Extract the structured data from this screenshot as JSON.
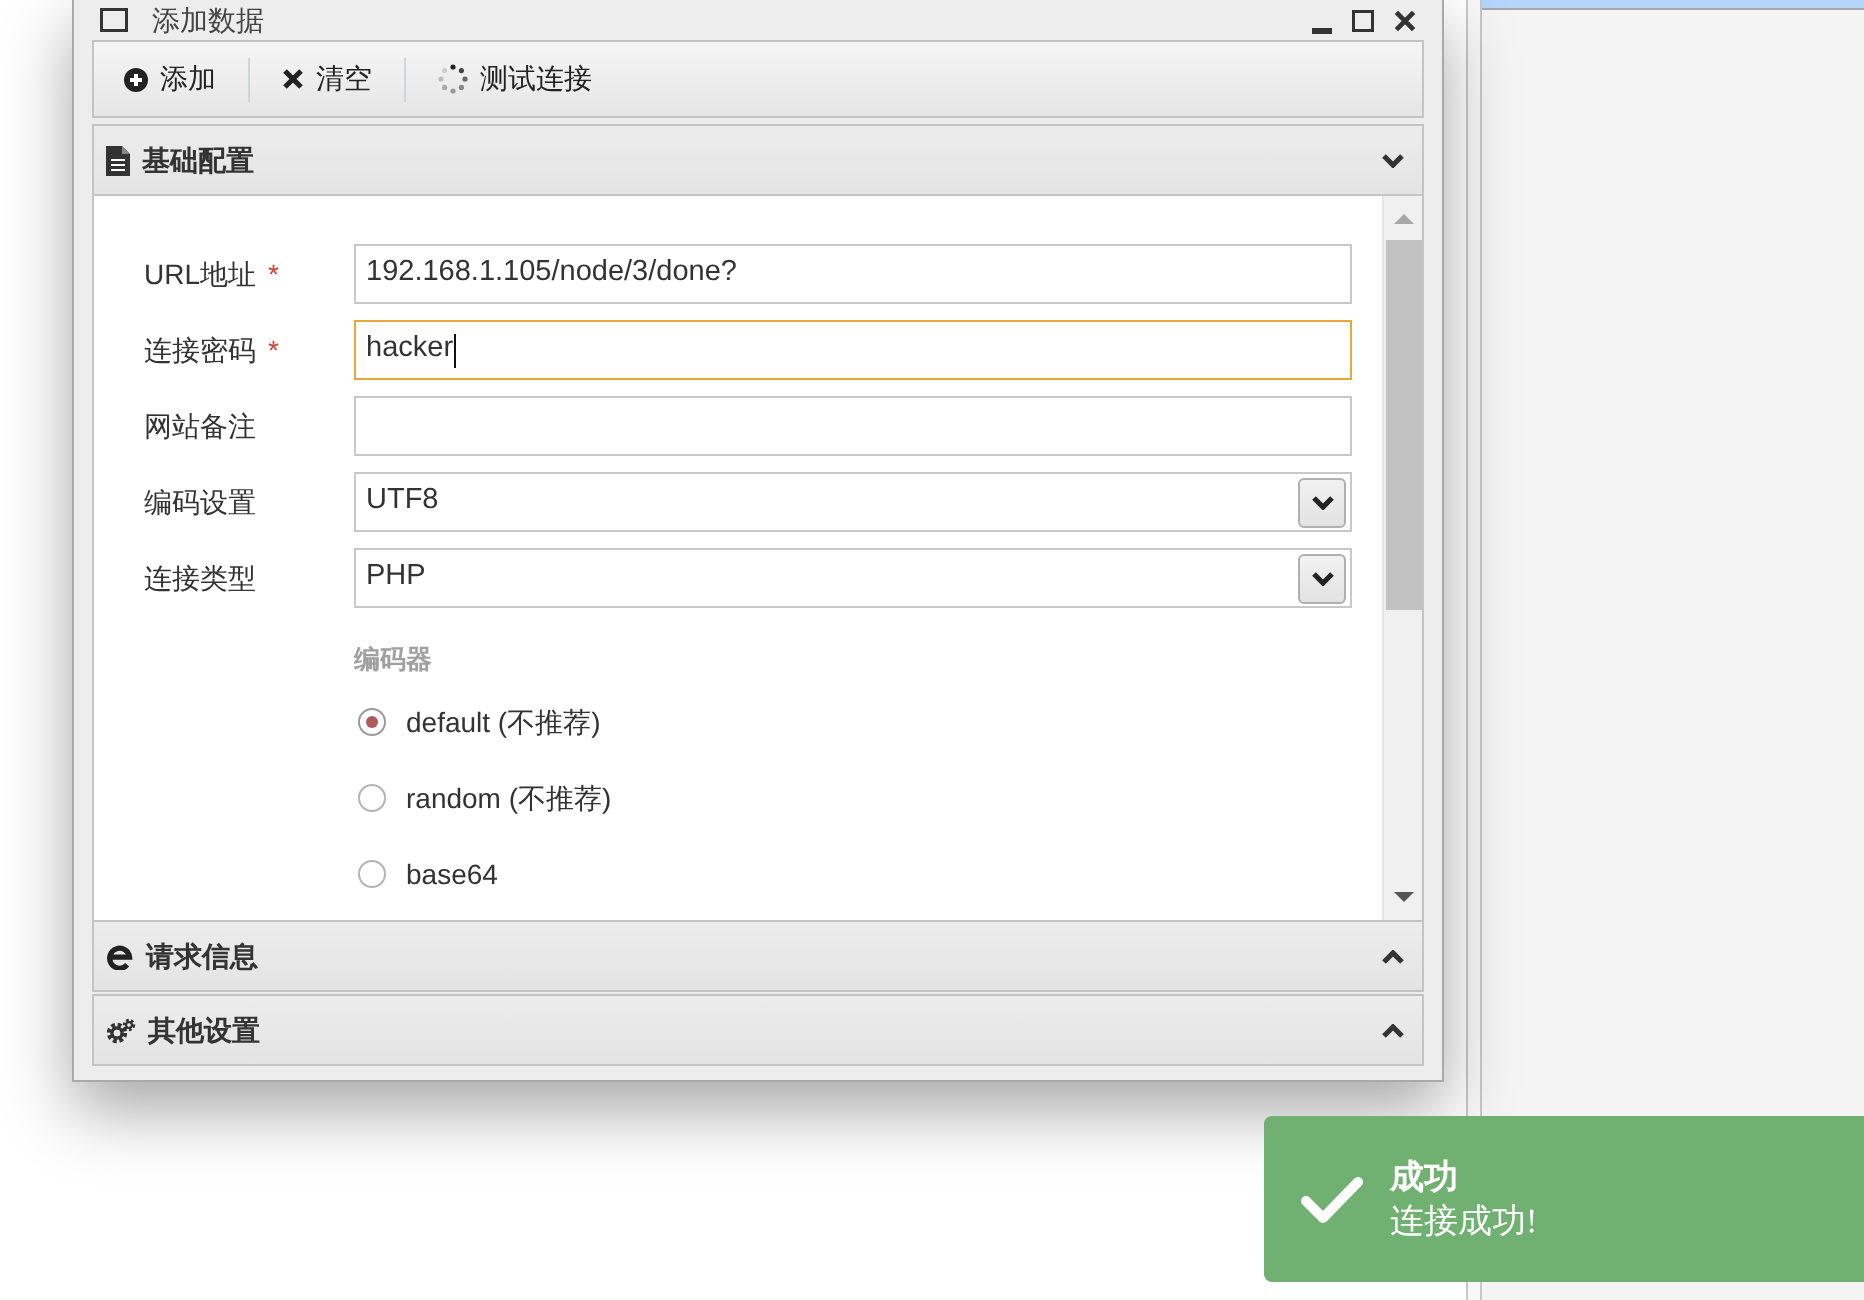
{
  "window": {
    "title": "添加数据"
  },
  "toolbar": {
    "buttons": [
      {
        "label": "添加"
      },
      {
        "label": "清空"
      },
      {
        "label": "测试连接"
      }
    ]
  },
  "sections": [
    {
      "title": "基础配置",
      "expanded": true,
      "fields": [
        {
          "kind": "text",
          "label": "URL地址",
          "required_mark": "*",
          "value": "192.168.1.105/node/3/done?",
          "focused": false
        },
        {
          "kind": "text",
          "label": "连接密码",
          "required_mark": "*",
          "value": "hacker",
          "focused": true
        },
        {
          "kind": "text",
          "label": "网站备注",
          "focused": false
        },
        {
          "kind": "select",
          "label": "编码设置",
          "value": "UTF8",
          "focused": false
        },
        {
          "kind": "select",
          "label": "连接类型",
          "value": "PHP",
          "focused": false
        }
      ],
      "encoder": {
        "label": "编码器",
        "options": [
          {
            "label": "default (不推荐)",
            "selected": true
          },
          {
            "label": "random (不推荐)",
            "selected": false
          },
          {
            "label": "base64",
            "selected": false
          }
        ]
      }
    },
    {
      "title": "请求信息",
      "expanded": false
    },
    {
      "title": "其他设置",
      "expanded": false
    }
  ],
  "toast": {
    "title": "成功",
    "message": "连接成功!"
  }
}
